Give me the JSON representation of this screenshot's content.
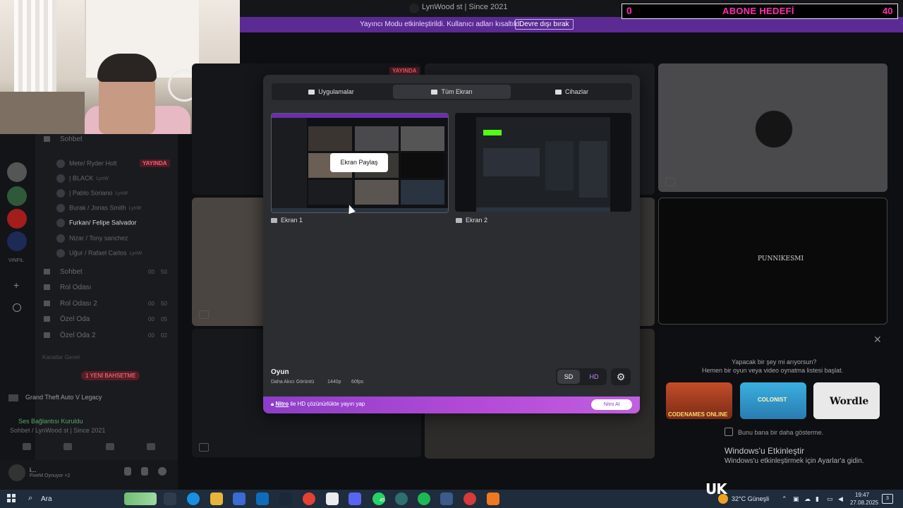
{
  "window": {
    "title": "LynWood st | Since 2021",
    "streamer_banner": "Yayıncı Modu etkinleştirildi. Kullanıcı adları kısaltıldı.",
    "streamer_disable_button": "Devre dışı bırak"
  },
  "overlay": {
    "abone_left": "0",
    "abone_title": "ABONE HEDEFİ",
    "abone_right": "40",
    "brand_color": "#ff2fae"
  },
  "sidebar": {
    "server_header": "Sohbet",
    "server_label": "VINFIL",
    "channels": [
      {
        "name": "Sohbet",
        "count_a": "00",
        "count_b": "50"
      },
      {
        "name": "Rol Odası",
        "count_a": "",
        "count_b": ""
      },
      {
        "name": "Rol Odası 2",
        "count_a": "00",
        "count_b": "50"
      },
      {
        "name": "Özel Oda",
        "count_a": "00",
        "count_b": "05"
      },
      {
        "name": "Özel Oda 2",
        "count_a": "00",
        "count_b": "02"
      }
    ],
    "voice_users": [
      {
        "name": "Mete/ Ryder Holt",
        "tag": ""
      },
      {
        "name": "| BLACK",
        "tag": "LynW"
      },
      {
        "name": "| Pablo Soriano",
        "tag": "LynW"
      },
      {
        "name": "Burak / Jonas Smith",
        "tag": "LynW"
      },
      {
        "name": "Furkan/ Felipe Salvador",
        "tag": ""
      },
      {
        "name": "Nizar / Tony sanchez",
        "tag": ""
      },
      {
        "name": "Uğur / Rafael Carlos",
        "tag": "LynW"
      }
    ],
    "live_tag": "YAYINDA",
    "category_label": "Kanallar Genel",
    "new_messages": "1 YENİ BAHSETME",
    "now_playing": "Grand Theft Auto V Legacy",
    "voice_status": "Ses Bağlantısı Kuruldu",
    "voice_channel": "Sohbet / LynWood st | Since 2021",
    "user_name": "i...",
    "user_status": "FiveM Oynuyor +2"
  },
  "tiles": {
    "live_tag": "YAYINDA",
    "brand_text": "PUNNIKESMI"
  },
  "activity": {
    "title": "Yapacak bir şey mi arıyorsun?",
    "subtitle": "Hemen bir oyun veya video oynatma listesi başlat.",
    "games": [
      "CODENAMES ONLINE",
      "COLONIST",
      "Wordle"
    ],
    "dont_show": "Bunu bana bir daha gösterme."
  },
  "windows_activation": {
    "title": "Windows'u Etkinleştir",
    "subtitle": "Windows'u etkinleştirmek için Ayarlar'a gidin."
  },
  "modal": {
    "tabs": [
      {
        "label": "Uygulamalar",
        "active": false
      },
      {
        "label": "Tüm Ekran",
        "active": true
      },
      {
        "label": "Cihazlar",
        "active": false
      }
    ],
    "screens": [
      {
        "label": "Ekran 1"
      },
      {
        "label": "Ekran 2"
      }
    ],
    "share_button": "Ekran Paylaş",
    "quality_title": "Oyun",
    "quality_desc": "Daha Akıcı Görüntü",
    "resolution": "1440p",
    "fps": "60fps",
    "sd_label": "SD",
    "hd_label": "HD",
    "nitro_brand": "Nitro",
    "nitro_text": "ile HD çözünürlükte yayın yap",
    "nitro_button": "Nitro Al",
    "accent": "#b54bd8"
  },
  "taskbar": {
    "search": "Ara",
    "badge_count": "45",
    "uk_logo": "UK",
    "weather": "32°C  Güneşli",
    "time": "19:47",
    "date": "27.08.2025",
    "notif_count": "3"
  }
}
